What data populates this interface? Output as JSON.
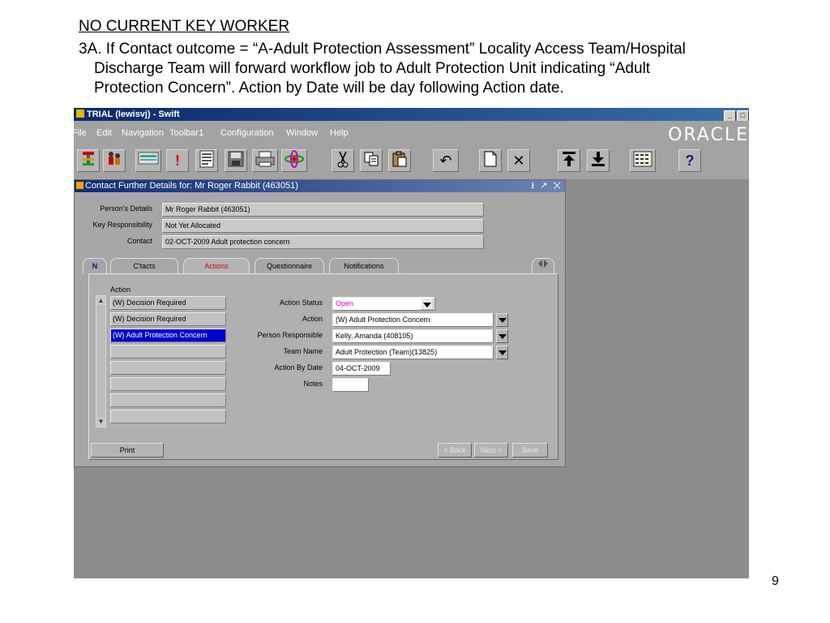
{
  "slide": {
    "heading": "NO CURRENT KEY WORKER",
    "body_line1": "3A. If Contact outcome = “A-Adult Protection Assessment” Locality Access Team/Hospital",
    "body_line2": "Discharge Team will forward workflow job to Adult Protection Unit indicating “Adult",
    "body_line3": "Protection Concern”.  Action by Date will be day following Action date.",
    "page_number": "9"
  },
  "app": {
    "title": "TRIAL (lewisvj) - Swift",
    "brand": "ORACLE",
    "menu": [
      "File",
      "Edit",
      "Navigation",
      "Toolbar1",
      "Configuration",
      "Window",
      "Help"
    ]
  },
  "toolbar": {
    "icons": [
      "person-tree-icon",
      "people-icon",
      "card-icon",
      "alert-icon",
      "form-icon",
      "save-icon",
      "print-icon",
      "atom-icon",
      "cut-icon",
      "copy-icon",
      "paste-icon",
      "undo-icon",
      "new-icon",
      "clear-icon",
      "first-record-icon",
      "download-icon",
      "grid-icon",
      "help-icon"
    ],
    "undo_glyph": "↶",
    "clear_glyph": "✕",
    "help_glyph": "?",
    "alert_glyph": "!"
  },
  "window": {
    "title": "Contact Further Details for:  Mr Roger Rabbit (463051)",
    "controls": "⭳ ↗ ✕"
  },
  "details": {
    "person_label": "Person's Details",
    "person_value": "Mr Roger Rabbit (463051)",
    "keyresp_label": "Key Responsibility",
    "keyresp_value": "Not Yet Allocated",
    "contact_label": "Contact",
    "contact_value": "02-OCT-2009 Adult protection concern"
  },
  "tabs": [
    "C'tacts",
    "Actions",
    "Questionnaire",
    "Notifications"
  ],
  "tab_nav_glyph": "N",
  "actions": {
    "list_header": "Action",
    "list": [
      "(W) Decision Required",
      "(W) Decision Required",
      "(W) Adult Protection Concern",
      "",
      "",
      "",
      "",
      ""
    ],
    "status_label": "Action Status",
    "status_value": "Open",
    "action_label": "Action",
    "action_value": "(W) Adult Protection Concern",
    "person_label": "Person Responsible",
    "person_value": "Kelly, Amanda (408105)",
    "team_label": "Team Name",
    "team_value": "Adult Protection (Team)(13825)",
    "date_label": "Action By Date",
    "date_value": "04-OCT-2009",
    "notes_label": "Notes",
    "notes_value": ""
  },
  "buttons": {
    "print": "Print",
    "back": "< Back",
    "next": "Next >",
    "save": "Save"
  },
  "colors": {
    "status_open": "#e000e0",
    "active_tab": "#e00000",
    "selected_row": "#0000cc"
  }
}
